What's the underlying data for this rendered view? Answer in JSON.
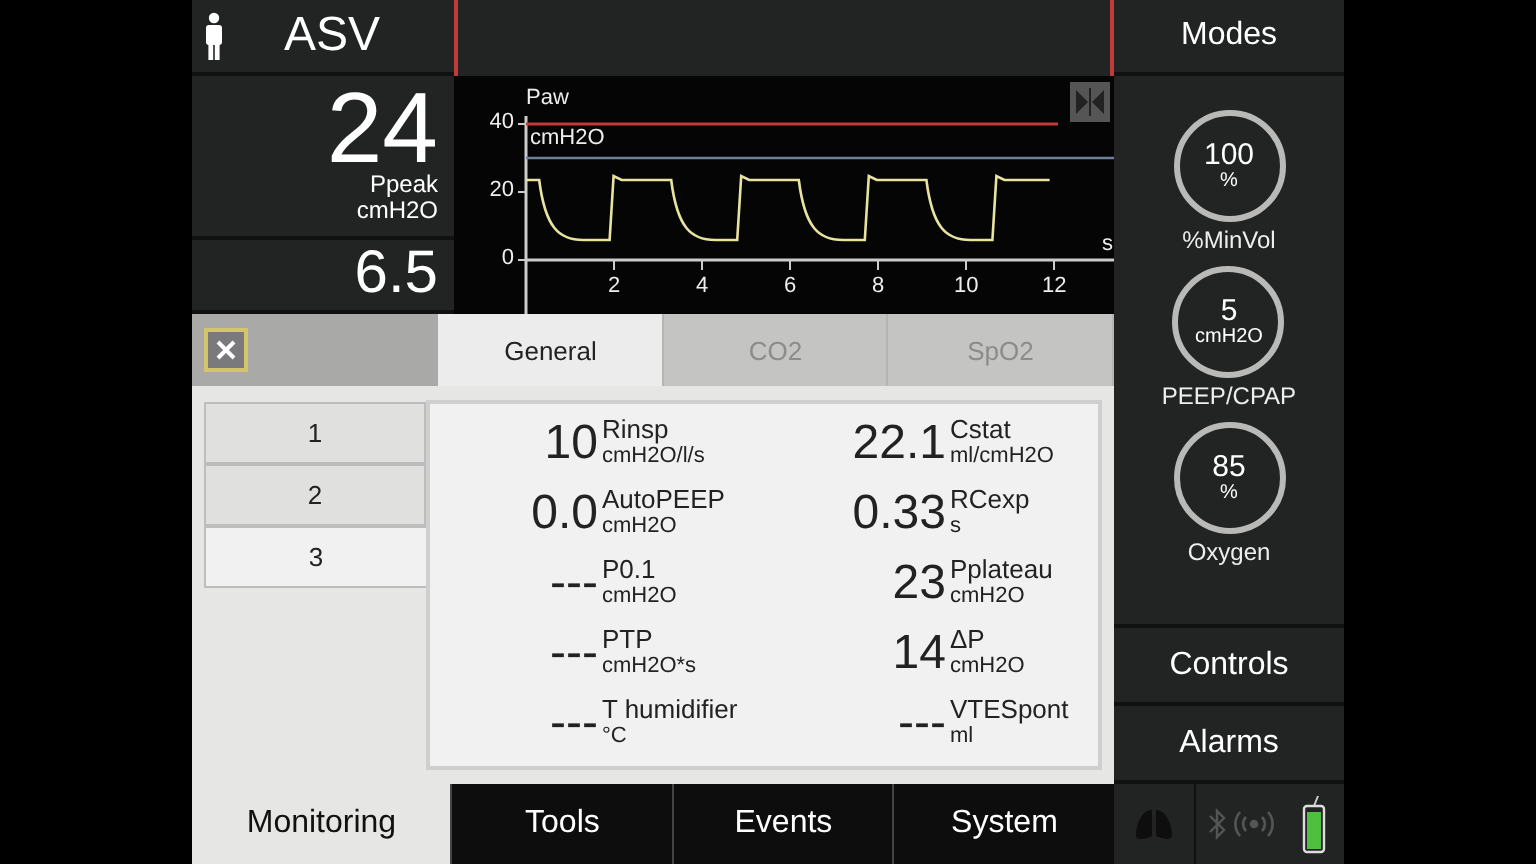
{
  "header": {
    "mode": "ASV"
  },
  "modes_button": {
    "label": "Modes"
  },
  "readings": [
    {
      "value": "24",
      "name": "Ppeak",
      "unit": "cmH2O"
    },
    {
      "value": "6.5"
    }
  ],
  "waveform": {
    "title": "Paw",
    "unit": "cmH2O",
    "y_ticks": [
      "40",
      "20",
      "0"
    ],
    "x_ticks": [
      "2",
      "4",
      "6",
      "8",
      "10",
      "12"
    ],
    "x_unit": "s"
  },
  "controls": [
    {
      "value": "100",
      "unit": "%",
      "name": "%MinVol"
    },
    {
      "value": "5",
      "unit": "cmH2O",
      "name": "PEEP/CPAP"
    },
    {
      "value": "85",
      "unit": "%",
      "name": "Oxygen"
    }
  ],
  "side_buttons": [
    {
      "label": "Controls"
    },
    {
      "label": "Alarms"
    }
  ],
  "monitoring": {
    "tabs": [
      {
        "label": "General",
        "selected": true,
        "disabled": false
      },
      {
        "label": "CO2",
        "selected": false,
        "disabled": true
      },
      {
        "label": "SpO2",
        "selected": false,
        "disabled": true
      }
    ],
    "pages": [
      {
        "label": "1",
        "selected": false
      },
      {
        "label": "2",
        "selected": false
      },
      {
        "label": "3",
        "selected": true
      }
    ],
    "parameters": [
      {
        "value": "10",
        "name": "Rinsp",
        "unit": "cmH2O/l/s"
      },
      {
        "value": "22.1",
        "name": "Cstat",
        "unit": "ml/cmH2O"
      },
      {
        "value": "0.0",
        "name": "AutoPEEP",
        "unit": "cmH2O"
      },
      {
        "value": "0.33",
        "name": "RCexp",
        "unit": "s"
      },
      {
        "value": "---",
        "name": "P0.1",
        "unit": "cmH2O"
      },
      {
        "value": "23",
        "name": "Pplateau",
        "unit": "cmH2O"
      },
      {
        "value": "---",
        "name": "PTP",
        "unit": "cmH2O*s"
      },
      {
        "value": "14",
        "name": "ΔP",
        "unit": "cmH2O"
      },
      {
        "value": "---",
        "name": "T humidifier",
        "unit": "°C"
      },
      {
        "value": "---",
        "name": "VTESpont",
        "unit": "ml"
      }
    ]
  },
  "nav_tabs": [
    {
      "label": "Monitoring",
      "selected": true
    },
    {
      "label": "Tools",
      "selected": false
    },
    {
      "label": "Events",
      "selected": false
    },
    {
      "label": "System",
      "selected": false
    }
  ]
}
